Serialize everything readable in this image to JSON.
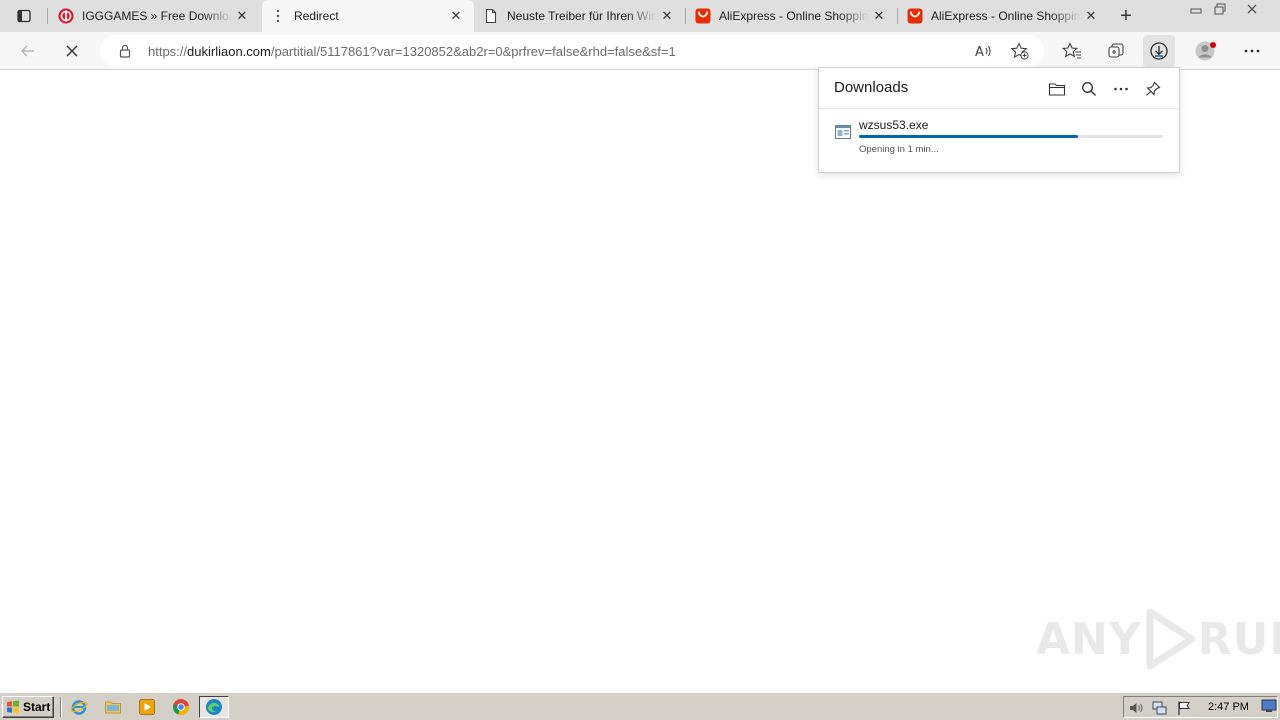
{
  "tabs": [
    {
      "title": "IGGGAMES » Free Download PC Games",
      "favicon": "igggames-favicon",
      "active": false
    },
    {
      "title": "Redirect",
      "favicon": "loading-spinner-icon",
      "active": true
    },
    {
      "title": "Neuste Treiber für Ihren Windows PC",
      "favicon": "page-icon",
      "active": false
    },
    {
      "title": "AliExpress - Online Shopping for Popular Electronics",
      "favicon": "aliexpress-favicon",
      "active": false
    },
    {
      "title": "AliExpress - Online Shopping for Popular Electronics",
      "favicon": "aliexpress-favicon",
      "active": false
    }
  ],
  "address_bar": {
    "url_prefix": "https://",
    "url_host": "dukirliaon.com",
    "url_path": "/partitial/5117861?var=1320852&ab2r=0&prfrev=false&rhd=false&sf=1"
  },
  "downloads": {
    "title": "Downloads",
    "items": [
      {
        "filename": "wzsus53.exe",
        "status": "Opening in 1 min...",
        "progress_percent": 72
      }
    ]
  },
  "watermark": {
    "left": "ANY",
    "right": "RUN"
  },
  "taskbar": {
    "start_label": "Start",
    "clock": "2:47 PM"
  },
  "colors": {
    "accent": "#0067c0",
    "aliexpress": "#e62e04",
    "igggames": "#e0162b"
  }
}
